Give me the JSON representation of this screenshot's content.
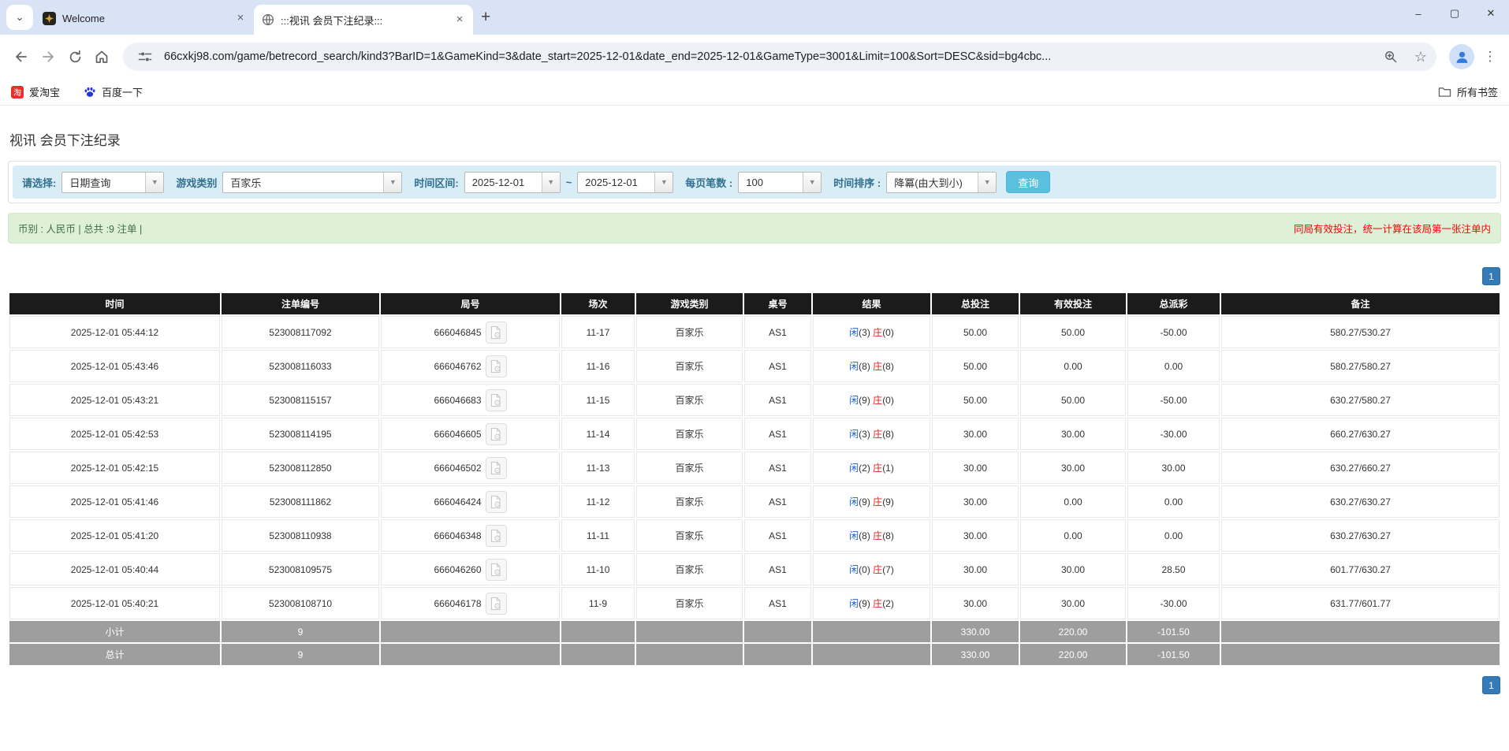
{
  "browser": {
    "tab_search_icon": "⌄",
    "tabs": [
      {
        "title": "Welcome"
      },
      {
        "title": ":::视讯 会员下注纪录:::"
      }
    ],
    "close_tab_icon": "×",
    "new_tab_icon": "+",
    "window_controls": {
      "minimize": "–",
      "maximize": "▢",
      "close": "✕"
    },
    "url": "66cxkj98.com/game/betrecord_search/kind3?BarID=1&GameKind=3&date_start=2025-12-01&date_end=2025-12-01&GameType=3001&Limit=100&Sort=DESC&sid=bg4cbc...",
    "star_icon": "☆",
    "menu_icon": "⋮",
    "bookmarks": [
      {
        "label": "爱淘宝",
        "badge": "淘"
      },
      {
        "label": "百度一下"
      }
    ],
    "all_bookmarks_label": "所有书签"
  },
  "page": {
    "title": "视讯 会员下注纪录",
    "filters": {
      "select_label": "请选择:",
      "select_value": "日期查询",
      "game_label": "游戏类别",
      "game_value": "百家乐",
      "range_label": "时间区间:",
      "date_start": "2025-12-01",
      "tilde": "~",
      "date_end": "2025-12-01",
      "per_page_label": "每页笔数 :",
      "per_page_value": "100",
      "sort_label": "时间排序 :",
      "sort_value": "降冪(由大到小)",
      "search_button": "查询",
      "arrow_icon": "▼"
    },
    "summary": {
      "left": "币别 : 人民币 | 总共 :9 注单 |",
      "right": "同局有效投注，统一计算在该局第一张注单内"
    },
    "pagination": {
      "page_1": "1"
    },
    "table": {
      "headers": [
        "时间",
        "注单编号",
        "局号",
        "场次",
        "游戏类别",
        "桌号",
        "结果",
        "总投注",
        "有效投注",
        "总派彩",
        "备注"
      ],
      "rows": [
        {
          "time": "2025-12-01 05:44:12",
          "bet_id": "523008117092",
          "round_id": "666046845",
          "session": "11-17",
          "game": "百家乐",
          "table_no": "AS1",
          "player": "闲",
          "player_pts": "(3)",
          "banker": "庄",
          "banker_pts": "(0)",
          "total_bet": "50.00",
          "valid_bet": "50.00",
          "payout": "-50.00",
          "remark": "580.27/530.27"
        },
        {
          "time": "2025-12-01 05:43:46",
          "bet_id": "523008116033",
          "round_id": "666046762",
          "session": "11-16",
          "game": "百家乐",
          "table_no": "AS1",
          "player": "闲",
          "player_pts": "(8)",
          "banker": "庄",
          "banker_pts": "(8)",
          "total_bet": "50.00",
          "valid_bet": "0.00",
          "payout": "0.00",
          "remark": "580.27/580.27"
        },
        {
          "time": "2025-12-01 05:43:21",
          "bet_id": "523008115157",
          "round_id": "666046683",
          "session": "11-15",
          "game": "百家乐",
          "table_no": "AS1",
          "player": "闲",
          "player_pts": "(9)",
          "banker": "庄",
          "banker_pts": "(0)",
          "total_bet": "50.00",
          "valid_bet": "50.00",
          "payout": "-50.00",
          "remark": "630.27/580.27"
        },
        {
          "time": "2025-12-01 05:42:53",
          "bet_id": "523008114195",
          "round_id": "666046605",
          "session": "11-14",
          "game": "百家乐",
          "table_no": "AS1",
          "player": "闲",
          "player_pts": "(3)",
          "banker": "庄",
          "banker_pts": "(8)",
          "total_bet": "30.00",
          "valid_bet": "30.00",
          "payout": "-30.00",
          "remark": "660.27/630.27"
        },
        {
          "time": "2025-12-01 05:42:15",
          "bet_id": "523008112850",
          "round_id": "666046502",
          "session": "11-13",
          "game": "百家乐",
          "table_no": "AS1",
          "player": "闲",
          "player_pts": "(2)",
          "banker": "庄",
          "banker_pts": "(1)",
          "total_bet": "30.00",
          "valid_bet": "30.00",
          "payout": "30.00",
          "remark": "630.27/660.27"
        },
        {
          "time": "2025-12-01 05:41:46",
          "bet_id": "523008111862",
          "round_id": "666046424",
          "session": "11-12",
          "game": "百家乐",
          "table_no": "AS1",
          "player": "闲",
          "player_pts": "(9)",
          "banker": "庄",
          "banker_pts": "(9)",
          "total_bet": "30.00",
          "valid_bet": "0.00",
          "payout": "0.00",
          "remark": "630.27/630.27"
        },
        {
          "time": "2025-12-01 05:41:20",
          "bet_id": "523008110938",
          "round_id": "666046348",
          "session": "11-11",
          "game": "百家乐",
          "table_no": "AS1",
          "player": "闲",
          "player_pts": "(8)",
          "banker": "庄",
          "banker_pts": "(8)",
          "total_bet": "30.00",
          "valid_bet": "0.00",
          "payout": "0.00",
          "remark": "630.27/630.27"
        },
        {
          "time": "2025-12-01 05:40:44",
          "bet_id": "523008109575",
          "round_id": "666046260",
          "session": "11-10",
          "game": "百家乐",
          "table_no": "AS1",
          "player": "闲",
          "player_pts": "(0)",
          "banker": "庄",
          "banker_pts": "(7)",
          "total_bet": "30.00",
          "valid_bet": "30.00",
          "payout": "28.50",
          "remark": "601.77/630.27"
        },
        {
          "time": "2025-12-01 05:40:21",
          "bet_id": "523008108710",
          "round_id": "666046178",
          "session": "11-9",
          "game": "百家乐",
          "table_no": "AS1",
          "player": "闲",
          "player_pts": "(9)",
          "banker": "庄",
          "banker_pts": "(2)",
          "total_bet": "30.00",
          "valid_bet": "30.00",
          "payout": "-30.00",
          "remark": "631.77/601.77"
        }
      ],
      "subtotal": {
        "label": "小计",
        "count": "9",
        "total_bet": "330.00",
        "valid_bet": "220.00",
        "payout": "-101.50"
      },
      "total": {
        "label": "总计",
        "count": "9",
        "total_bet": "330.00",
        "valid_bet": "220.00",
        "payout": "-101.50"
      }
    }
  }
}
